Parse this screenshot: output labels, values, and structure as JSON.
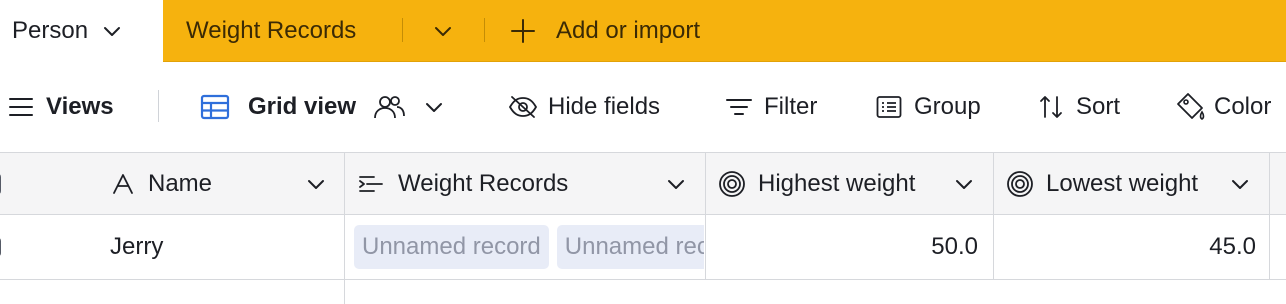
{
  "tabs": {
    "table_name": "Person",
    "active_table": "Weight Records",
    "add_import_label": "Add or import"
  },
  "toolbar": {
    "views_label": "Views",
    "view_name": "Grid view",
    "hide_fields_label": "Hide fields",
    "filter_label": "Filter",
    "group_label": "Group",
    "sort_label": "Sort",
    "color_label": "Color"
  },
  "columns": [
    {
      "label": "Name",
      "icon": "text-field-icon"
    },
    {
      "label": "Weight Records",
      "icon": "link-field-icon"
    },
    {
      "label": "Highest weight",
      "icon": "rollup-field-icon"
    },
    {
      "label": "Lowest weight",
      "icon": "rollup-field-icon"
    }
  ],
  "rows": [
    {
      "name": "Jerry",
      "weight_records": [
        "Unnamed record",
        "Unnamed record"
      ],
      "highest_weight": "50.0",
      "lowest_weight": "45.0"
    }
  ],
  "colors": {
    "accent": "#f6b20e",
    "header_bg": "#f5f5f6",
    "chip_bg": "#e8ecf7",
    "chip_text": "#9196a6",
    "grid_view_icon": "#2f6fdb"
  }
}
